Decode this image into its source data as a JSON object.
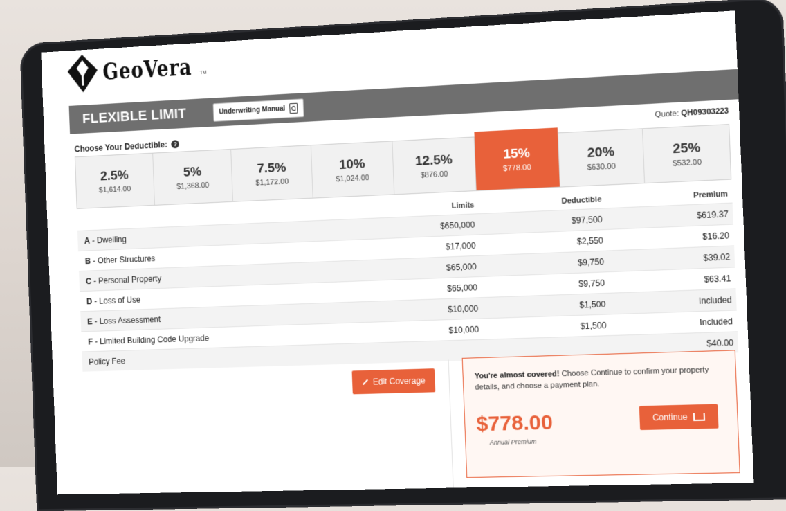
{
  "brand": {
    "name": "GeoVera",
    "tm": "TM"
  },
  "header": {
    "title": "FLEXIBLE LIMIT",
    "underwriting_label": "Underwriting Manual",
    "quote_label": "Quote:",
    "quote_number": "QH09303223"
  },
  "deductible": {
    "label": "Choose Your Deductible:",
    "options": [
      {
        "pct": "2.5%",
        "amount": "$1,614.00"
      },
      {
        "pct": "5%",
        "amount": "$1,368.00"
      },
      {
        "pct": "7.5%",
        "amount": "$1,172.00"
      },
      {
        "pct": "10%",
        "amount": "$1,024.00"
      },
      {
        "pct": "12.5%",
        "amount": "$876.00"
      },
      {
        "pct": "15%",
        "amount": "$778.00"
      },
      {
        "pct": "20%",
        "amount": "$630.00"
      },
      {
        "pct": "25%",
        "amount": "$532.00"
      }
    ],
    "selected_index": 5
  },
  "coverage": {
    "headers": {
      "limits": "Limits",
      "deductible": "Deductible",
      "premium": "Premium"
    },
    "rows": [
      {
        "letter": "A",
        "name": " - Dwelling",
        "limit": "$650,000",
        "deductible": "$97,500",
        "premium": "$619.37"
      },
      {
        "letter": "B",
        "name": " - Other Structures",
        "limit": "$17,000",
        "deductible": "$2,550",
        "premium": "$16.20"
      },
      {
        "letter": "C",
        "name": " - Personal Property",
        "limit": "$65,000",
        "deductible": "$9,750",
        "premium": "$39.02"
      },
      {
        "letter": "D",
        "name": " - Loss of Use",
        "limit": "$65,000",
        "deductible": "$9,750",
        "premium": "$63.41"
      },
      {
        "letter": "E",
        "name": " - Loss Assessment",
        "limit": "$10,000",
        "deductible": "$1,500",
        "premium": "Included"
      },
      {
        "letter": "F",
        "name": " - Limited Building Code Upgrade",
        "limit": "$10,000",
        "deductible": "$1,500",
        "premium": "Included"
      },
      {
        "letter": "",
        "name": "Policy Fee",
        "limit": "",
        "deductible": "",
        "premium": "$40.00"
      }
    ]
  },
  "actions": {
    "edit_label": "Edit Coverage",
    "continue_label": "Continue"
  },
  "summary": {
    "bold": "You're almost covered!",
    "text": " Choose Continue to confirm your property details, and choose a payment plan.",
    "price": "$778.00",
    "price_caption": "Annual Premium"
  },
  "colors": {
    "accent": "#e8613a",
    "header_bar": "#6f6f6f"
  }
}
